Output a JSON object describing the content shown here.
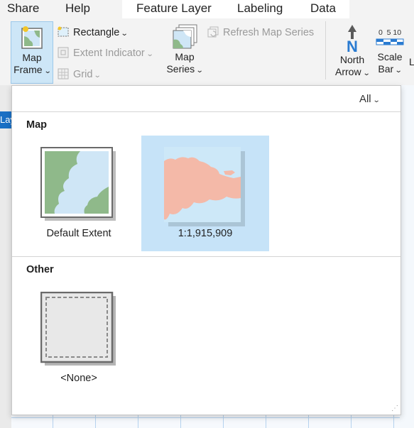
{
  "ribbon": {
    "tabs": [
      "Share",
      "Help"
    ],
    "contextual_tabs": [
      "Feature Layer",
      "Labeling",
      "Data"
    ],
    "map_frame": {
      "line1": "Map",
      "line2": "Frame"
    },
    "rectangle": "Rectangle",
    "extent_indicator": "Extent Indicator",
    "grid": "Grid",
    "map_series": {
      "line1": "Map",
      "line2": "Series"
    },
    "refresh_map_series": "Refresh Map Series",
    "north_arrow": {
      "glyph": "N",
      "line1": "North",
      "line2": "Arrow"
    },
    "scale_bar": {
      "ticks": "0  5 10",
      "line1": "Scale",
      "line2": "Bar"
    },
    "cut_label": "L"
  },
  "background": {
    "layout_tab": "Lay"
  },
  "gallery": {
    "filter": "All",
    "sections": [
      {
        "title": "Map",
        "items": [
          {
            "caption": "Default Extent",
            "selected": false
          },
          {
            "caption": "1:1,915,909",
            "selected": true
          }
        ]
      },
      {
        "title": "Other",
        "items": [
          {
            "caption": "<None>",
            "selected": false
          }
        ]
      }
    ]
  },
  "colors": {
    "accent": "#1a6fc4",
    "selected_bg": "#c6e3f8",
    "map_water": "#cfe6f6",
    "map_land": "#8fb98a",
    "map_highlight": "#f4b9a8"
  }
}
